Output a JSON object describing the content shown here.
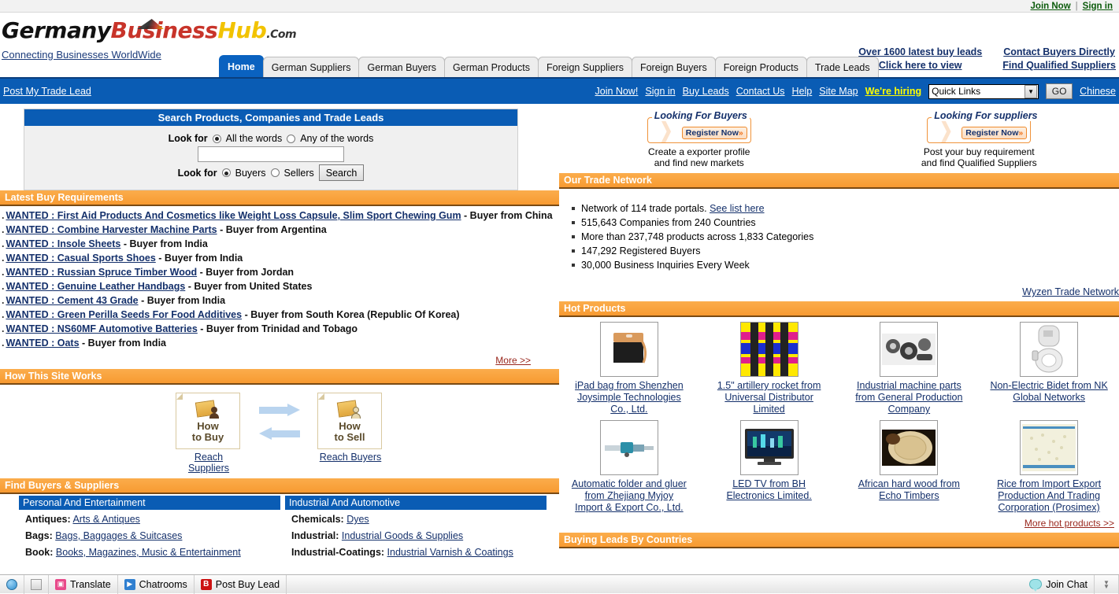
{
  "topbar": {
    "join_now": "Join Now",
    "separator": "|",
    "sign_in": "Sign in"
  },
  "brand": {
    "name_part1": "Germany",
    "name_part2": "Business",
    "name_part3": "Hub",
    "name_suffix": ".Com",
    "tagline": "Connecting Businesses WorldWide"
  },
  "promos": [
    {
      "line1": "Over  1600  latest  buy leads",
      "line2": "Click here  to view"
    },
    {
      "line1": "Contact  Buyers  Directly",
      "line2": "Find  Qualified  Suppliers"
    }
  ],
  "tabs": [
    {
      "label": "Home",
      "active": true
    },
    {
      "label": "German Suppliers",
      "active": false
    },
    {
      "label": "German Buyers",
      "active": false
    },
    {
      "label": "German Products",
      "active": false
    },
    {
      "label": "Foreign Suppliers",
      "active": false
    },
    {
      "label": "Foreign Buyers",
      "active": false
    },
    {
      "label": "Foreign Products",
      "active": false
    },
    {
      "label": "Trade Leads",
      "active": false
    }
  ],
  "navbar": {
    "post_lead": "Post My Trade Lead",
    "links": [
      "Join Now!",
      "Sign in",
      "Buy Leads",
      "Contact Us",
      "Help",
      "Site Map"
    ],
    "hiring": "We're hiring",
    "quick_links_value": "Quick Links",
    "go_label": "GO",
    "chinese": "Chinese"
  },
  "search": {
    "header": "Search Products, Companies and Trade Leads",
    "look_for_label_1": "Look for",
    "option_all_words": "All the words",
    "option_any_words": "Any of the words",
    "input_value": "",
    "look_for_label_2": "Look for",
    "option_buyers": "Buyers",
    "option_sellers": "Sellers",
    "search_button": "Search"
  },
  "latest_buy": {
    "header": "Latest Buy Requirements",
    "more": "More >>",
    "items": [
      {
        "link": "WANTED : First Aid Products And Cosmetics like Weight Loss Capsule, Slim Sport Chewing Gum",
        "suffix": "- Buyer from China"
      },
      {
        "link": "WANTED : Combine Harvester Machine Parts",
        "suffix": "- Buyer from Argentina"
      },
      {
        "link": "WANTED : Insole Sheets",
        "suffix": "- Buyer from India"
      },
      {
        "link": "WANTED : Casual Sports Shoes",
        "suffix": "- Buyer from India"
      },
      {
        "link": "WANTED : Russian Spruce Timber Wood",
        "suffix": "- Buyer from Jordan"
      },
      {
        "link": "WANTED : Genuine Leather Handbags",
        "suffix": "- Buyer from United States"
      },
      {
        "link": "WANTED : Cement 43 Grade",
        "suffix": "- Buyer from India"
      },
      {
        "link": "WANTED : Green Perilla Seeds For Food Additives",
        "suffix": "- Buyer from South Korea (Republic Of Korea)"
      },
      {
        "link": "WANTED : NS60MF Automotive Batteries",
        "suffix": "- Buyer from Trinidad and Tobago"
      },
      {
        "link": "WANTED : Oats",
        "suffix": "- Buyer from India"
      }
    ]
  },
  "how_it_works": {
    "header": "How This Site Works",
    "buy_line1": "How",
    "buy_line2": "to Buy",
    "buy_link": "Reach Suppliers",
    "sell_line1": "How",
    "sell_line2": "to Sell",
    "sell_link": "Reach Buyers"
  },
  "find": {
    "header": "Find Buyers & Suppliers",
    "col1_header": "Personal And Entertainment",
    "col2_header": "Industrial And Automotive",
    "col1_rows": [
      {
        "label": "Antiques:",
        "link": "Arts & Antiques"
      },
      {
        "label": "Bags:",
        "link": "Bags, Baggages & Suitcases"
      },
      {
        "label": "Book:",
        "link": "Books, Magazines, Music & Entertainment"
      }
    ],
    "col2_rows": [
      {
        "label": "Chemicals:",
        "link": "Dyes"
      },
      {
        "label": "Industrial:",
        "link": "Industrial Goods & Supplies"
      },
      {
        "label": "Industrial-Coatings:",
        "link": "Industrial Varnish & Coatings"
      }
    ]
  },
  "looking": [
    {
      "title": "Looking For Buyers",
      "button": "Register Now",
      "cap1": "Create a exporter profile",
      "cap2": "and find new markets"
    },
    {
      "title": "Looking For suppliers",
      "button": "Register Now",
      "cap1": "Post your buy requirement",
      "cap2": "and find Qualified Suppliers"
    }
  ],
  "trade_network": {
    "header": "Our Trade Network",
    "items": [
      {
        "text": "Network of 114 trade portals.",
        "link": "See list here"
      },
      {
        "text": "515,643 Companies from 240 Countries",
        "link": ""
      },
      {
        "text": "More than 237,748 products across 1,833 Categories",
        "link": ""
      },
      {
        "text": "147,292 Registered Buyers",
        "link": ""
      },
      {
        "text": "30,000 Business Inquiries Every Week",
        "link": ""
      }
    ],
    "wyzen": "Wyzen Trade Network"
  },
  "hot_products": {
    "header": "Hot Products",
    "more": "More hot products >>",
    "items": [
      {
        "caption": "iPad bag from Shenzhen Joysimple Technologies Co., Ltd.",
        "image": "bag-image"
      },
      {
        "caption": "1.5\" artillery rocket from Universal Distributor Limited",
        "image": "rocket-image"
      },
      {
        "caption": "Industrial machine parts from General Production Company",
        "image": "machine-parts-image"
      },
      {
        "caption": "Non-Electric Bidet from NK Global Networks",
        "image": "bidet-image"
      },
      {
        "caption": "Automatic folder and gluer from Zhejiang Myjoy Import & Export Co., Ltd.",
        "image": "folder-gluer-image"
      },
      {
        "caption": "LED TV from BH Electronics Limited.",
        "image": "led-tv-image"
      },
      {
        "caption": "African hard wood from Echo Timbers",
        "image": "hardwood-image"
      },
      {
        "caption": "Rice from Import Export Production And Trading Corporation (Prosimex)",
        "image": "rice-image"
      }
    ]
  },
  "buying_leads": {
    "header": "Buying Leads By Countries"
  },
  "taskbar": {
    "items": [
      {
        "label": "",
        "icon": "globe-icon"
      },
      {
        "label": "",
        "icon": "page-icon"
      },
      {
        "label": "Translate",
        "icon": "translate-icon"
      },
      {
        "label": "Chatrooms",
        "icon": "chatrooms-icon"
      },
      {
        "label": "Post Buy Lead",
        "icon": "post-buy-lead-icon"
      }
    ],
    "join_chat": "Join Chat"
  },
  "colors": {
    "nav_blue": "#0a5cb4",
    "orange": "#f79a31",
    "link_blue": "#14306b",
    "dark_red": "#99271d",
    "hiring_yellow": "#ffff00"
  }
}
